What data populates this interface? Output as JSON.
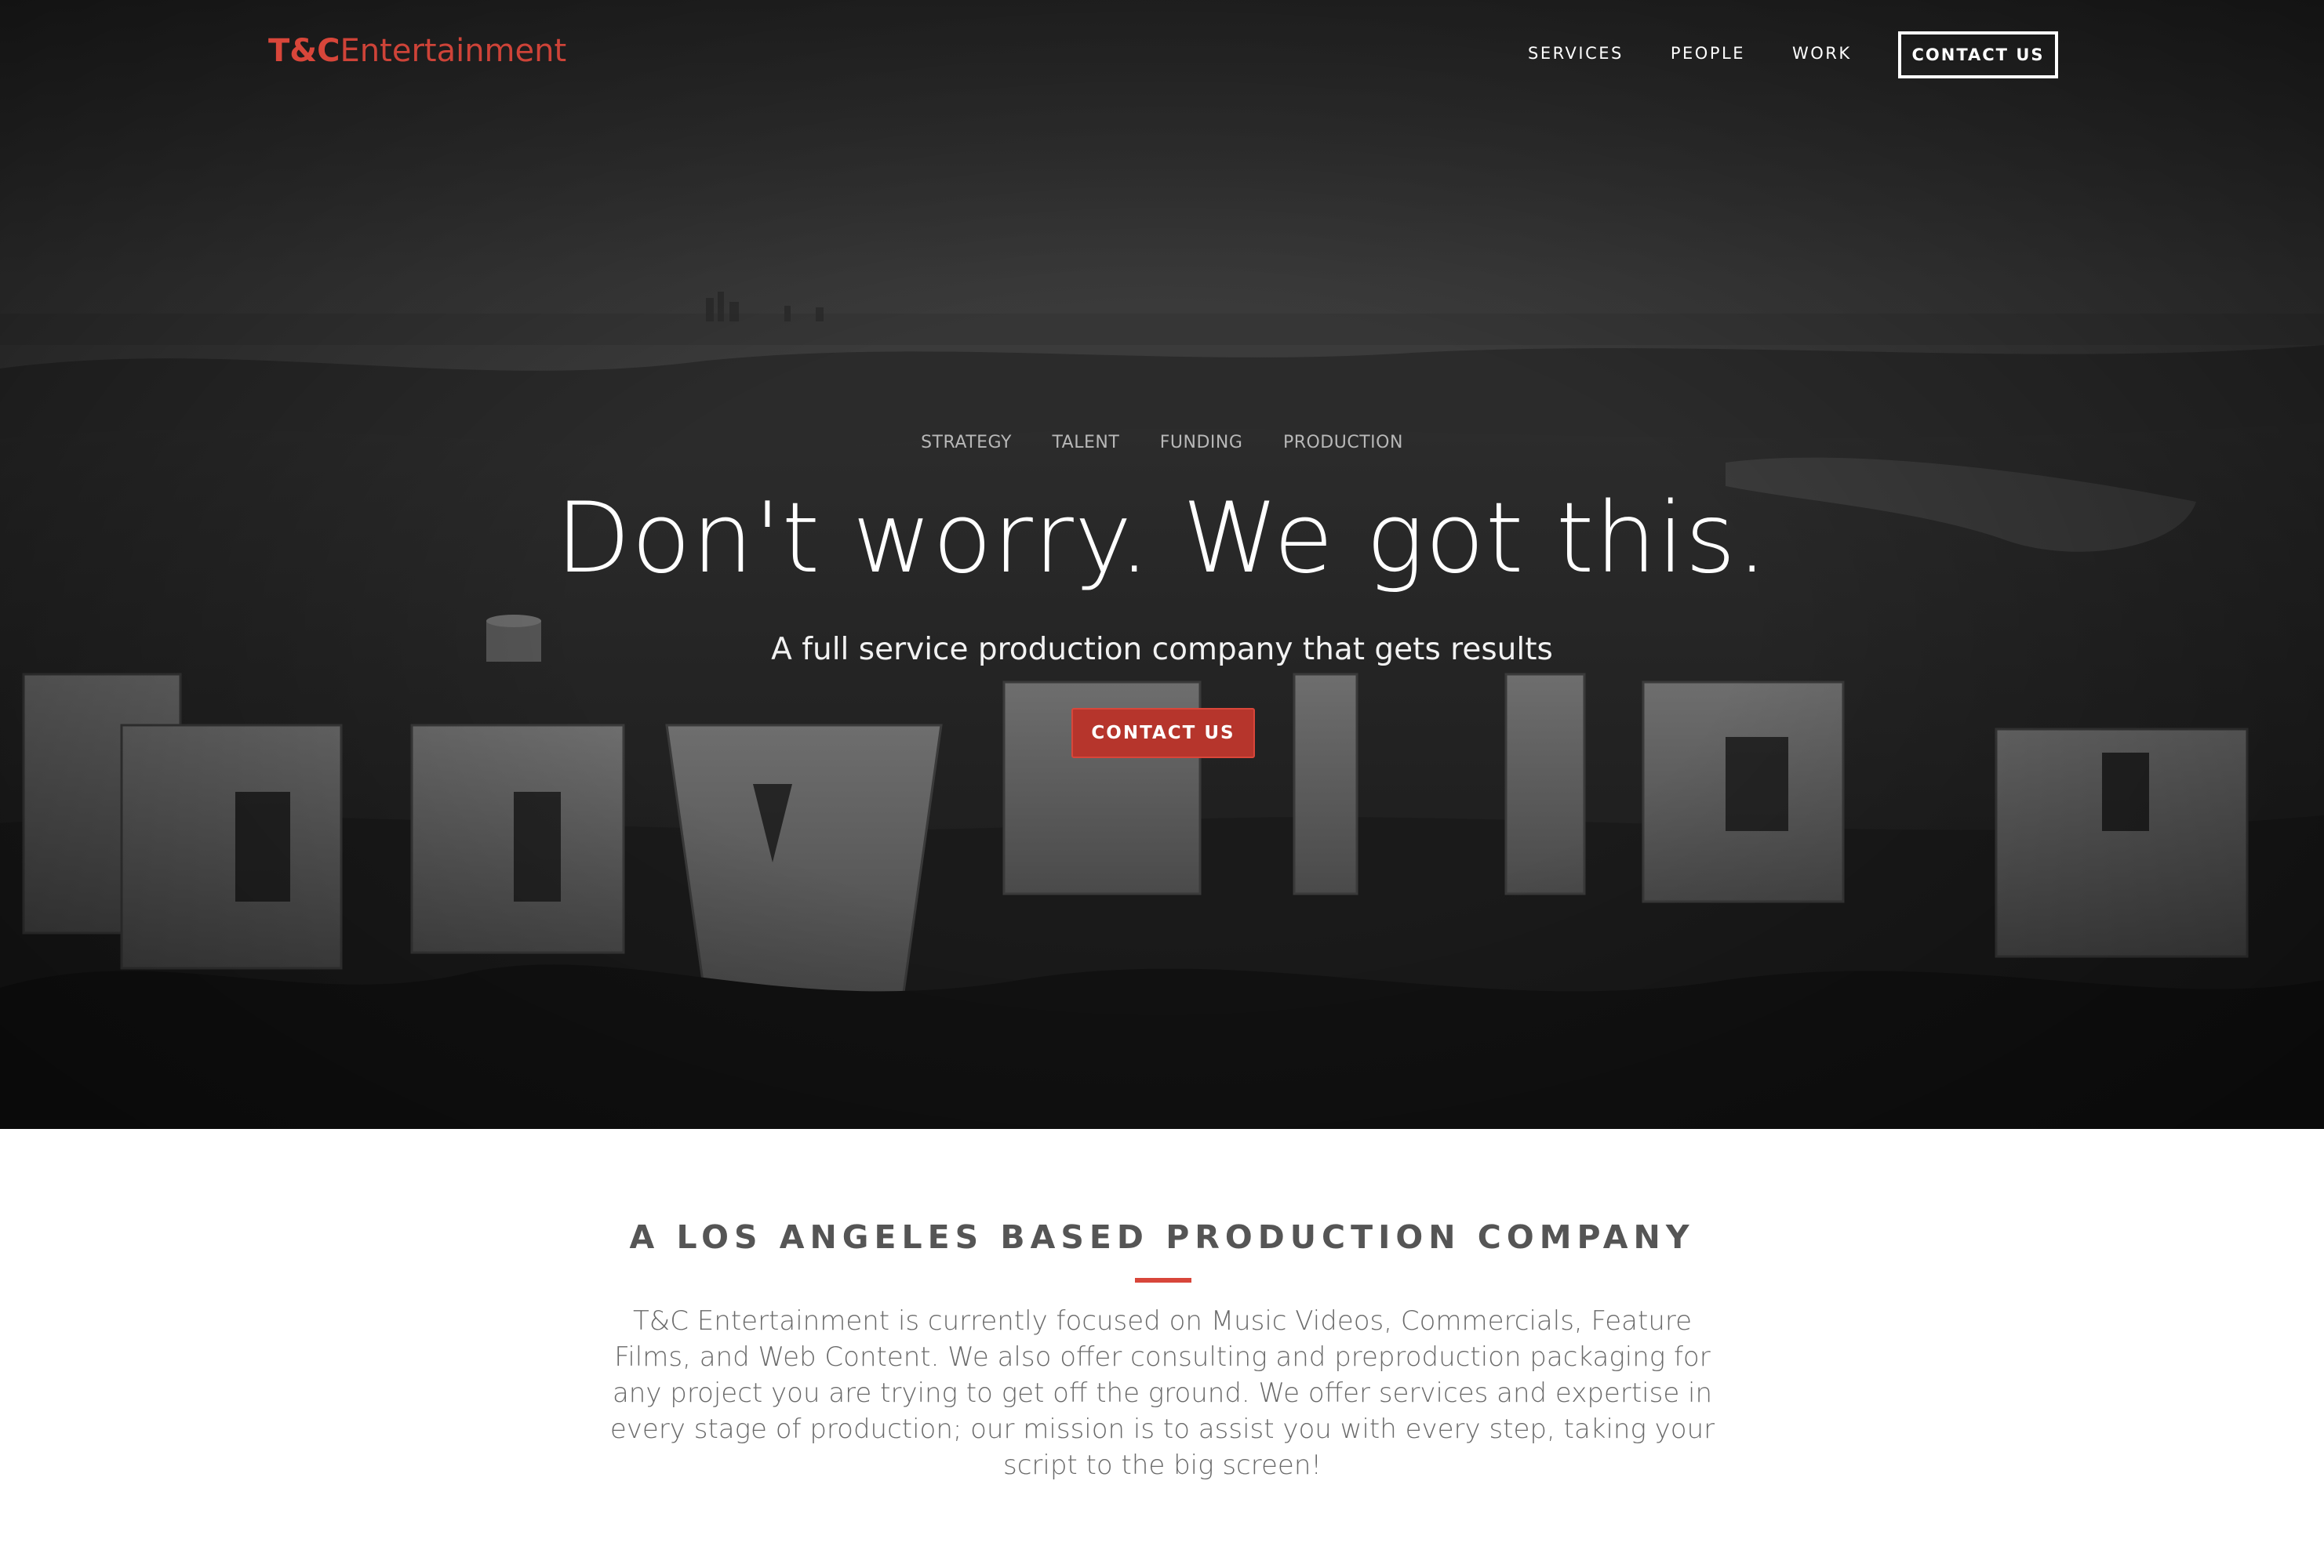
{
  "nav": {
    "logo_bold": "T&C",
    "logo_light": "Entertainment",
    "links": [
      {
        "label": "SERVICES"
      },
      {
        "label": "PEOPLE"
      },
      {
        "label": "WORK"
      }
    ],
    "cta_label": "CONTACT US"
  },
  "hero": {
    "services": [
      "STRATEGY",
      "TALENT",
      "FUNDING",
      "PRODUCTION"
    ],
    "headline": "Don't worry. We got this.",
    "subhead": "A full service production company that gets results",
    "cta_label": "CONTACT US",
    "background": "hollywood-sign-photo"
  },
  "about": {
    "title": "A LOS ANGELES BASED PRODUCTION COMPANY",
    "body": "T&C Entertainment is currently focused on Music Videos, Commercials, Feature Films, and Web Content. We also offer consulting and preproduction packaging for any project you are trying to get off the ground. We offer services and expertise in every stage of production; our mission is to assist you with every step, taking your script to the big screen!"
  },
  "colors": {
    "accent": "#d8463a",
    "hero_button": "#b6352c",
    "heading_text": "#555555",
    "body_text": "#6a6a6a"
  }
}
